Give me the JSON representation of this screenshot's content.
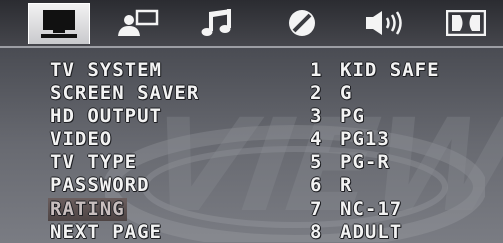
{
  "tabs": [
    {
      "icon": "tv-monitor-icon",
      "active": true
    },
    {
      "icon": "person-screen-icon",
      "active": false
    },
    {
      "icon": "music-note-icon",
      "active": false
    },
    {
      "icon": "disc-icon",
      "active": false
    },
    {
      "icon": "speaker-icon",
      "active": false
    },
    {
      "icon": "dolby-icon",
      "active": false
    }
  ],
  "watermark": "VIEW",
  "menu": {
    "items": [
      {
        "label": "TV SYSTEM"
      },
      {
        "label": "SCREEN SAVER"
      },
      {
        "label": "HD OUTPUT"
      },
      {
        "label": "VIDEO"
      },
      {
        "label": "TV TYPE"
      },
      {
        "label": "PASSWORD"
      },
      {
        "label": "RATING"
      },
      {
        "label": "NEXT PAGE"
      }
    ],
    "selected_index": 6
  },
  "rating_options": [
    {
      "num": "1",
      "label": "KID SAFE"
    },
    {
      "num": "2",
      "label": "G"
    },
    {
      "num": "3",
      "label": "PG"
    },
    {
      "num": "4",
      "label": "PG13"
    },
    {
      "num": "5",
      "label": "PG-R"
    },
    {
      "num": "6",
      "label": "R"
    },
    {
      "num": "7",
      "label": "NC-17"
    },
    {
      "num": "8",
      "label": "ADULT"
    }
  ]
}
